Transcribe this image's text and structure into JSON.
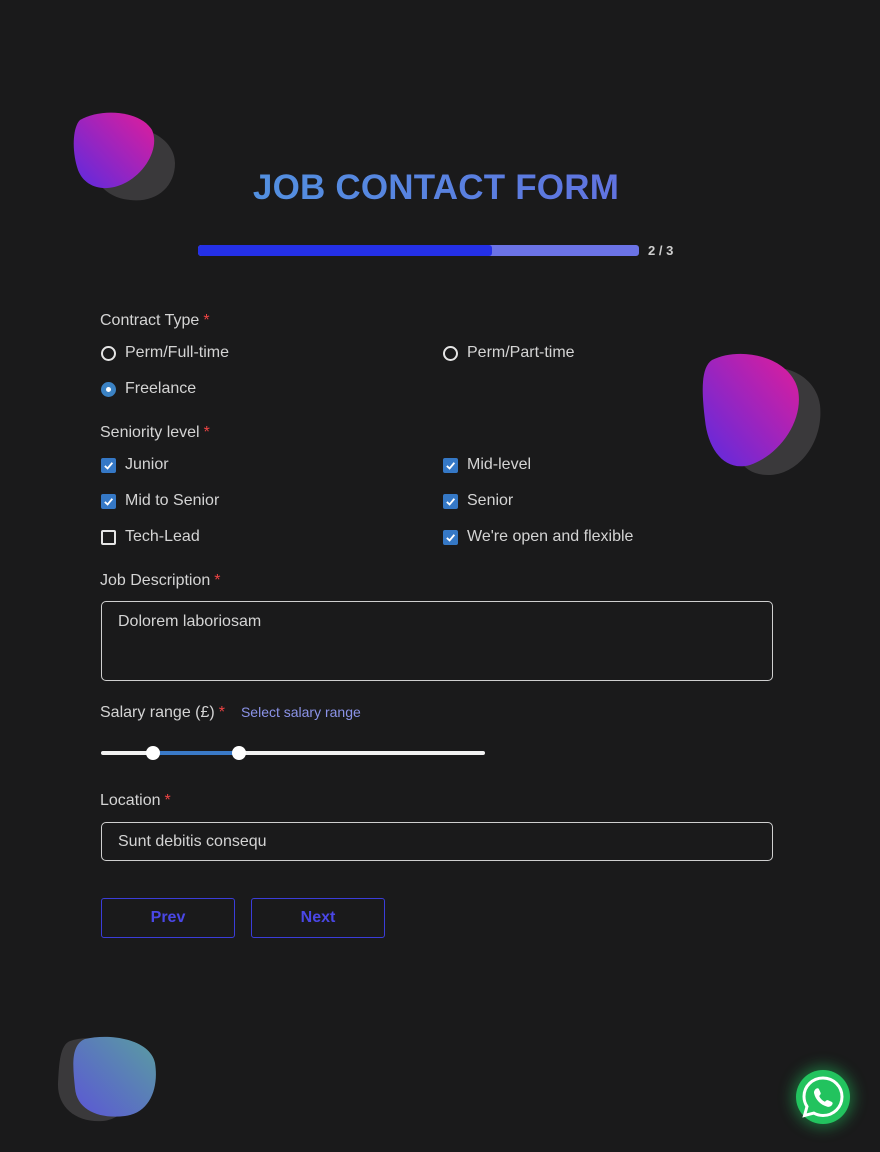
{
  "title": "JOB CONTACT FORM",
  "progress": {
    "text": "2 / 3",
    "fraction": 0.667
  },
  "contract": {
    "label": "Contract Type",
    "required": "*",
    "options": [
      {
        "label": "Perm/Full-time",
        "checked": false
      },
      {
        "label": "Perm/Part-time",
        "checked": false
      },
      {
        "label": "Freelance",
        "checked": true
      }
    ]
  },
  "seniority": {
    "label": "Seniority level",
    "required": "*",
    "options": [
      {
        "label": "Junior",
        "checked": true
      },
      {
        "label": "Mid-level",
        "checked": true
      },
      {
        "label": "Mid to Senior",
        "checked": true
      },
      {
        "label": "Senior",
        "checked": true
      },
      {
        "label": "Tech-Lead",
        "checked": false
      },
      {
        "label": "We're open and flexible",
        "checked": true
      }
    ]
  },
  "description": {
    "label": "Job Description",
    "required": "*",
    "value": "Dolorem laboriosam"
  },
  "salary": {
    "label": "Salary range (£)",
    "required": "*",
    "hint": "Select salary range",
    "range_low": 0.135,
    "range_high": 0.36
  },
  "location": {
    "label": "Location",
    "required": "*",
    "value": "Sunt debitis consequ"
  },
  "buttons": {
    "prev": "Prev",
    "next": "Next"
  },
  "colors": {
    "accent": "#3578c6",
    "button": "#4a47e6",
    "whatsapp": "#22c35e",
    "required": "#ef4444"
  },
  "icons": {
    "whatsapp": "whatsapp-icon"
  }
}
